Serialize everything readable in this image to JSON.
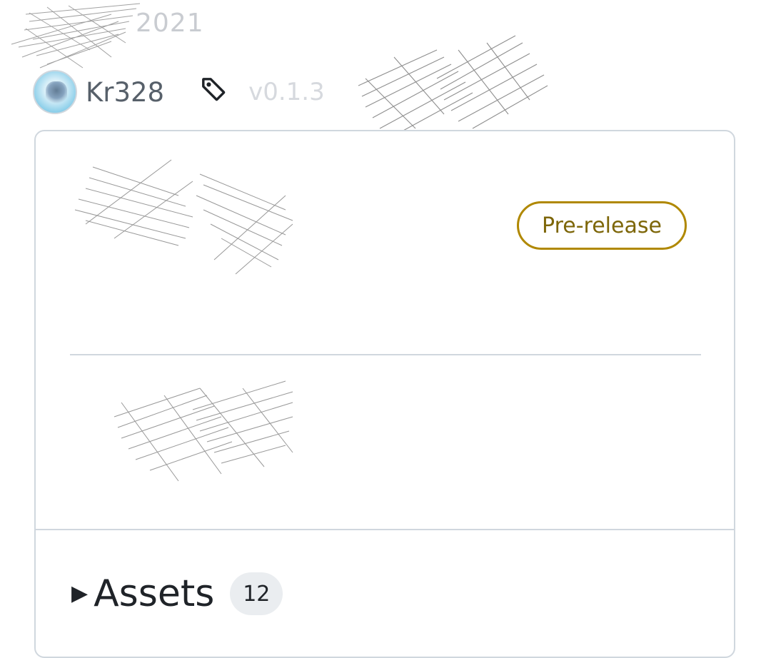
{
  "header": {
    "date_fragment": "2021",
    "author": "Kr328",
    "tag_name": "v0.1.3"
  },
  "release": {
    "badge_label": "Pre-release"
  },
  "assets": {
    "title": "Assets",
    "count": "12",
    "caret": "▶"
  },
  "colors": {
    "badge_border": "#b08800",
    "badge_text": "#7d6608",
    "border": "#d0d7de",
    "counter_bg": "#eaedf0"
  },
  "icons": {
    "tag": "tag-icon",
    "avatar": "avatar",
    "caret": "triangle-right-icon"
  }
}
